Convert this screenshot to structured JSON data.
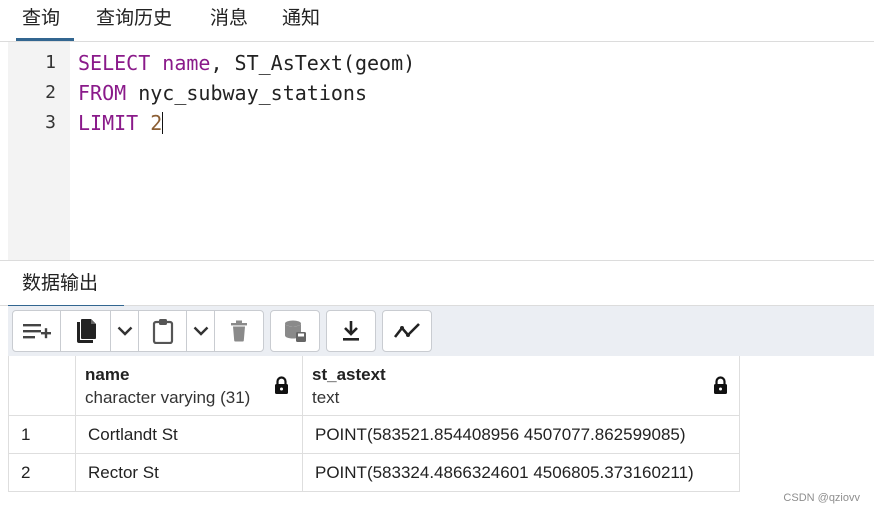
{
  "top_tabs": [
    {
      "label": "查询",
      "active": true
    },
    {
      "label": "查询历史",
      "active": false
    },
    {
      "label": "消息",
      "active": false
    },
    {
      "label": "通知",
      "active": false
    }
  ],
  "editor": {
    "line_numbers": [
      "1",
      "2",
      "3"
    ],
    "lines": [
      {
        "kw": "SELECT",
        "kw2": "name",
        "rest": ", ST_AsText(geom)"
      },
      {
        "kw": "FROM",
        "rest": " nyc_subway_stations"
      },
      {
        "kw": "LIMIT",
        "num": "2"
      }
    ]
  },
  "output_tab": {
    "label": "数据输出"
  },
  "toolbar": {
    "icons": [
      "add-row-icon",
      "copy-icon",
      "chevron-down-icon",
      "paste-icon",
      "chevron-down-icon",
      "delete-icon",
      "save-data-icon",
      "download-icon",
      "graph-visualiser-icon"
    ]
  },
  "grid": {
    "columns": [
      {
        "name": "name",
        "type": "character varying (31)",
        "locked": true
      },
      {
        "name": "st_astext",
        "type": "text",
        "locked": true
      }
    ],
    "rows": [
      {
        "num": "1",
        "cells": [
          "Cortlandt St",
          "POINT(583521.854408956 4507077.862599085)"
        ]
      },
      {
        "num": "2",
        "cells": [
          "Rector St",
          "POINT(583324.4866324601 4506805.373160211)"
        ]
      }
    ]
  },
  "watermark": "CSDN @qziovv",
  "colors": {
    "accent": "#326690",
    "keyword": "#8a1a8a",
    "number": "#8b5e34",
    "toolbar_bg": "#ebeef3"
  }
}
